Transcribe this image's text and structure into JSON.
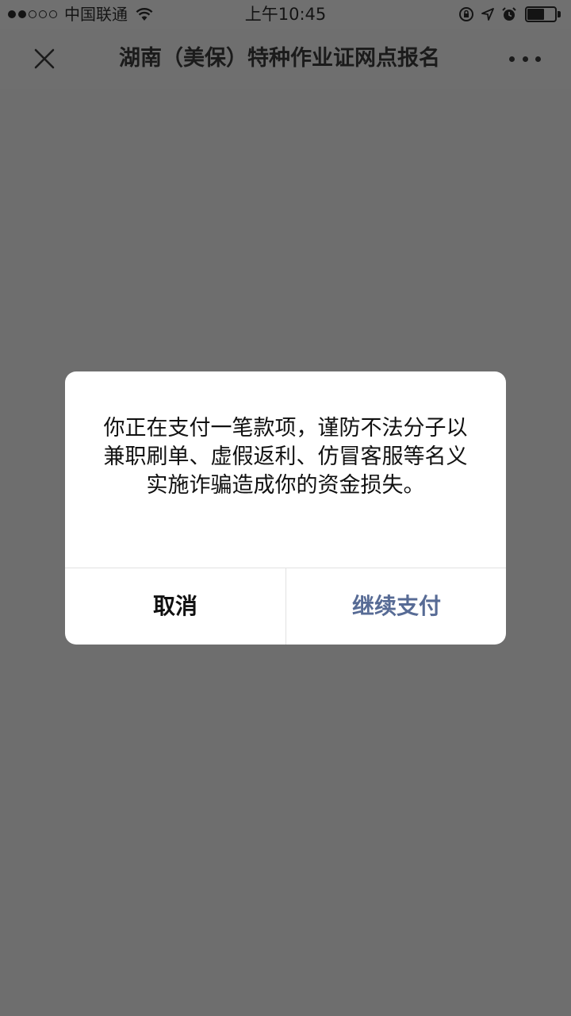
{
  "status_bar": {
    "carrier": "中国联通",
    "time": "上午10:45",
    "signal_bars_filled": 2,
    "signal_bars_total": 5,
    "battery_level": 0.62
  },
  "nav": {
    "title": "湖南（美保）特种作业证网点报名",
    "close_icon": "close-icon",
    "more_icon": "more-icon"
  },
  "dialog": {
    "message": "你正在支付一笔款项，谨防不法分子以兼职刷单、虚假返利、仿冒客服等名义实施诈骗造成你的资金损失。",
    "cancel_label": "取消",
    "confirm_label": "继续支付",
    "confirm_color": "#576b95"
  },
  "colors": {
    "overlay": "#6e6e6e",
    "dialog_bg": "#ffffff"
  }
}
